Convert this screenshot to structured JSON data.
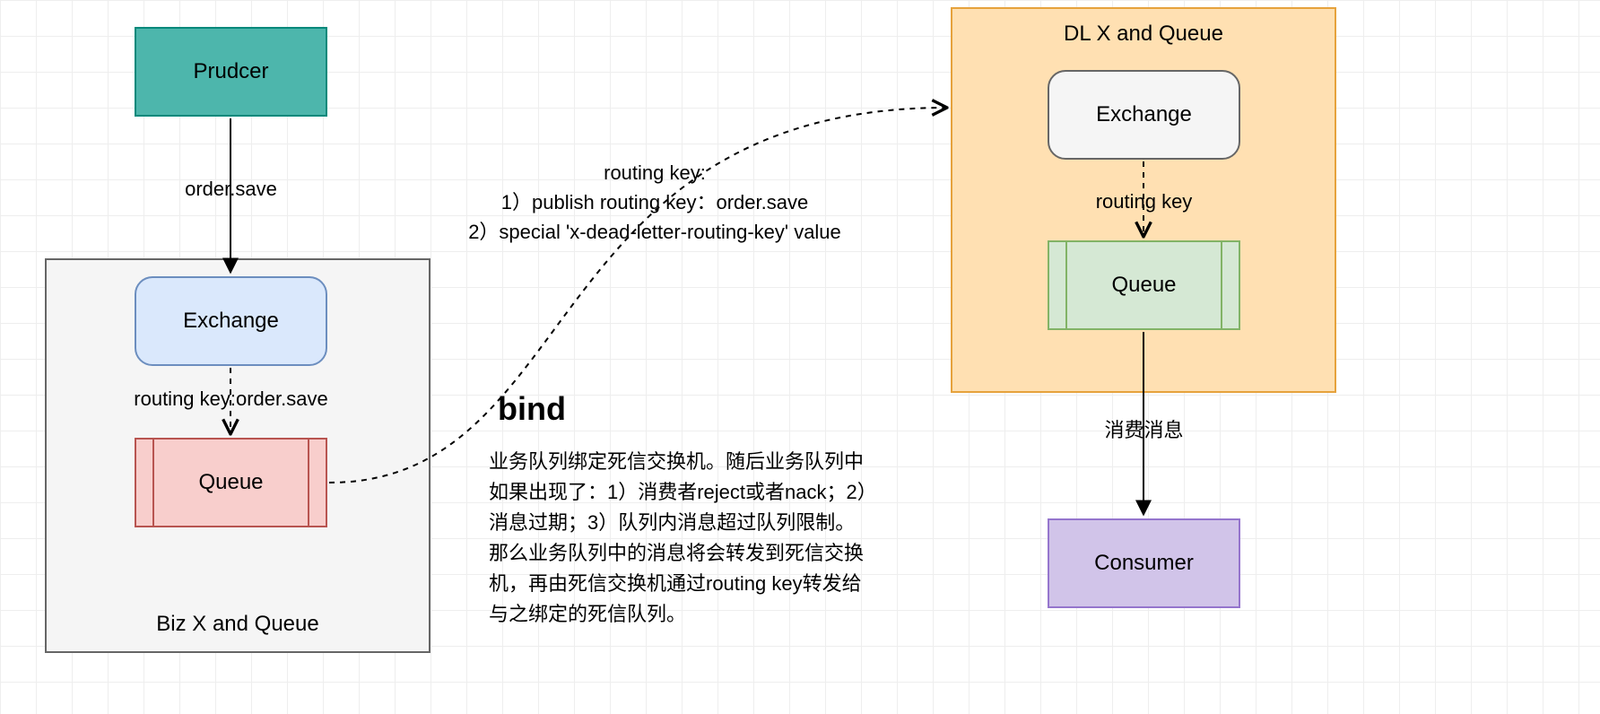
{
  "producer": {
    "label": "Prudcer"
  },
  "biz": {
    "container_label": "Biz X and Queue",
    "exchange_label": "Exchange",
    "queue_label": "Queue",
    "order_save_label": "order.save",
    "routing_key_label": "routing key:order.save"
  },
  "dlx": {
    "container_label": "DL X and Queue",
    "exchange_label": "Exchange",
    "queue_label": "Queue",
    "routing_key_label": "routing key",
    "consume_label": "消费消息"
  },
  "consumer": {
    "label": "Consumer"
  },
  "bind_label": "bind",
  "routing_note": "routing key:\n1）publish routing key：order.save\n2）special 'x-dead-letter-routing-key' value",
  "description": "业务队列绑定死信交换机。随后业务队列中如果出现了：1）消费者reject或者nack；2）消息过期；3）队列内消息超过队列限制。那么业务队列中的消息将会转发到死信交换机，再由死信交换机通过routing key转发给与之绑定的死信队列。"
}
